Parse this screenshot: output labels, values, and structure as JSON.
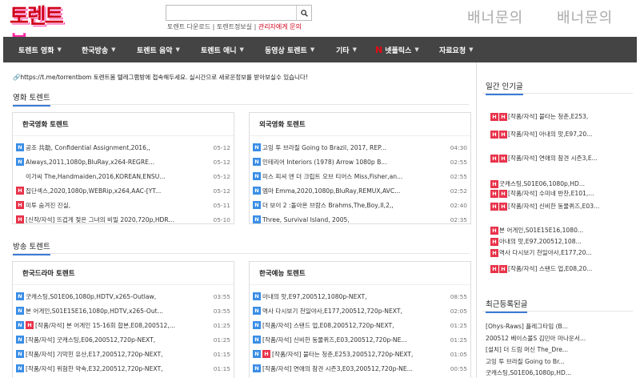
{
  "logo": {
    "part1": "토렌트",
    "part2": "봄"
  },
  "search": {
    "value": "",
    "placeholder": ""
  },
  "search_links": {
    "link1": "토렌트 다운로드",
    "sep": "|",
    "link2": "토렌트정보실",
    "link3": "관리자에게 문의"
  },
  "banners": [
    "배너문의",
    "배너문의"
  ],
  "nav": [
    {
      "label": "토렌트 영화",
      "caret": "▼"
    },
    {
      "label": "한국방송",
      "caret": "▼"
    },
    {
      "label": "토렌트 음악",
      "caret": "▼"
    },
    {
      "label": "토렌트 애니",
      "caret": "▼"
    },
    {
      "label": "동영상 토렌트",
      "caret": "▼"
    },
    {
      "label": "기타",
      "caret": "▼"
    },
    {
      "label": "넷플릭스",
      "caret": "▼",
      "prefix": "N"
    },
    {
      "label": "자료요청",
      "caret": "▼"
    }
  ],
  "notice": "🔗https://t.me/torrentbom 토렌트봄 텔레그램방에 접속해두세요. 실시간으로 새로운정보를 받아보실수 있습니다!",
  "sections": [
    {
      "title": "영화 토렌트",
      "boards": [
        {
          "title": "한국영화 토렌트",
          "rows": [
            {
              "badges": [
                "N"
              ],
              "title": "공조 共助, Confidential Assignment,2016,,",
              "date": "05-12"
            },
            {
              "badges": [
                "N"
              ],
              "title": "Always,2011,1080p,BluRay,x264-REGRE...",
              "date": "05-12"
            },
            {
              "badges": [
                ""
              ],
              "title": "이가씨 The,Handmaiden,2016,KOREAN,ENSU...",
              "date": "05-12"
            },
            {
              "badges": [
                "H"
              ],
              "title": "집단섹스,2020,1080p,WEBRip,x264,AAC-[YT...",
              "date": "05-12"
            },
            {
              "badges": [
                "H"
              ],
              "title": "미투 숨겨진 진실,",
              "date": "05-11"
            },
            {
              "badges": [
                "H"
              ],
              "title": "[신작/자석] 뜨겁게 젖은 그녀의 비밀 2020,720p,HDR...",
              "date": "05-10"
            }
          ]
        },
        {
          "title": "외국영화 토렌트",
          "rows": [
            {
              "badges": [
                "N"
              ],
              "title": "고잉 투 브라질 Going to Brazil, 2017, REP...",
              "date": "04:30"
            },
            {
              "badges": [
                "N"
              ],
              "title": "인테리어 Interiors (1978) Arrow 1080p B...",
              "date": "02:55"
            },
            {
              "badges": [
                "N"
              ],
              "title": "미스 피셔 앤 더 크립트 오브 티어스 Miss,Fisher,an...",
              "date": "02:55"
            },
            {
              "badges": [
                "N"
              ],
              "title": "엠마 Emma,2020,1080p,BluRay,REMUX,AVC...",
              "date": "02:52"
            },
            {
              "badges": [
                "N"
              ],
              "title": "더 보이 2 :돌아온 브람스 Brahms,The,Boy,II,2,,",
              "date": "02:40"
            },
            {
              "badges": [
                "N"
              ],
              "title": "Three, Survival Island, 2005,",
              "date": "02:35"
            }
          ]
        }
      ]
    },
    {
      "title": "방송 토렌트",
      "boards": [
        {
          "title": "한국드라마 토렌트",
          "rows": [
            {
              "badges": [
                "N"
              ],
              "title": "굿캐스팅,S01E06,1080p,HDTV,x265-Outlaw,",
              "date": "03:55"
            },
            {
              "badges": [
                "N"
              ],
              "title": "본 어게인,S01E15E16,1080p,HDTV,x265-Out...",
              "date": "03:55"
            },
            {
              "badges": [
                "N",
                "H"
              ],
              "title": "[작품/자석] 본 어게인 15-16회 합본,E08,200512,...",
              "date": "01:25"
            },
            {
              "badges": [
                "N"
              ],
              "title": "[작품/자석] 굿캐스팅,E06,200512,720p-NEXT,",
              "date": "01:25"
            },
            {
              "badges": [
                "N"
              ],
              "title": "[작품/자석] 기막힌 유산,E17,200512,720p-NEXT,",
              "date": "01:15"
            },
            {
              "badges": [
                "N"
              ],
              "title": "[작품/자석] 위험한 약속,E32,200512,720p-NEXT,",
              "date": "01:15"
            }
          ]
        },
        {
          "title": "한국예능 토렌트",
          "rows": [
            {
              "badges": [
                "N"
              ],
              "title": "아내의 맛,E97,200512,1080p-NEXT,",
              "date": "08:55"
            },
            {
              "badges": [
                "N"
              ],
              "title": "역사 다시보기 천일야사,E177,200512,720p-NEXT,",
              "date": "02:05"
            },
            {
              "badges": [
                "N"
              ],
              "title": "[작품/자석] 스탠드 업,E08,200512,720p-NEXT,",
              "date": "01:25"
            },
            {
              "badges": [
                "N"
              ],
              "title": "[작품/자석] 신비한 동물퀴즈,E03,200512,720p-NE...",
              "date": "01:25"
            },
            {
              "badges": [
                "N",
                "H"
              ],
              "title": "[작품/자석] 불타는 청춘,E253,200512,720p-NEXT,",
              "date": "01:05"
            },
            {
              "badges": [
                "N"
              ],
              "title": "[작품/자석] 연애의 참견 시즌3,E03,200512,720p-NE...",
              "date": "00:55"
            }
          ]
        }
      ]
    }
  ],
  "sidebar": {
    "popular_title": "일간 인기글",
    "popular": [
      {
        "badges": [
          "H",
          "H"
        ],
        "title": "[작품/자석] 불타는 청춘,E253,"
      },
      {
        "badges": [
          "H",
          "H"
        ],
        "title": "[작품/자석] 아내의 맛,E97,20..."
      },
      {
        "badges": [
          "H",
          "H"
        ],
        "title": "[작품/자석] 연애의 참견 시즌3,E..."
      },
      {
        "badges": [
          "H"
        ],
        "title": "굿캐스팅,S01E06,1080p,HD..."
      },
      {
        "badges": [
          "H",
          "H"
        ],
        "title": "[작품/자석] 수미네 반찬,E101,..."
      },
      {
        "badges": [
          "H",
          "H"
        ],
        "title": "[작품/자석] 신비한 동물퀴즈,E03..."
      },
      {
        "badges": [
          "H"
        ],
        "title": "본 어게인,S01E15E16,1080..."
      },
      {
        "badges": [
          "H"
        ],
        "title": "아내의 맛,E97,200512,108..."
      },
      {
        "badges": [
          "H"
        ],
        "title": "역사 다시보기 천일야사,E177,20..."
      },
      {
        "badges": [
          "H",
          "H"
        ],
        "title": "[작품/자석] 스탠드 업,E08,20..."
      }
    ],
    "recent_title": "최근등록된글",
    "recent": [
      "[Ohys-Raws] 플레그타임 (B...",
      "200512 베이스볼S 김민아 마나운서...",
      "[설치] 더 드림 머신 The_Dre...",
      "고잉 투 브라질 Going to Br...",
      "굿캐스팅,S01E06,1080p,HD..."
    ]
  }
}
